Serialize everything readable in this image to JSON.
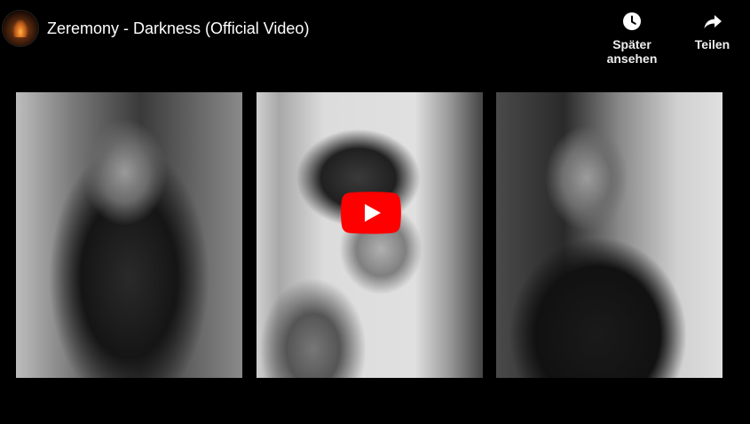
{
  "video": {
    "title": "Zeremony - Darkness (Official Video)"
  },
  "channel": {
    "avatar_icon": "channel-avatar-icon"
  },
  "actions": {
    "watch_later_label": "Später ansehen",
    "watch_later_icon": "clock-icon",
    "share_label": "Teilen",
    "share_icon": "share-arrow-icon"
  },
  "thumbnail": {
    "panels": [
      "panel-left",
      "panel-center",
      "panel-right"
    ]
  },
  "play_button": {
    "icon": "play-icon",
    "color": "#ff0000"
  },
  "colors": {
    "background": "#000000",
    "text": "#ffffff",
    "play_red": "#ff0000"
  }
}
